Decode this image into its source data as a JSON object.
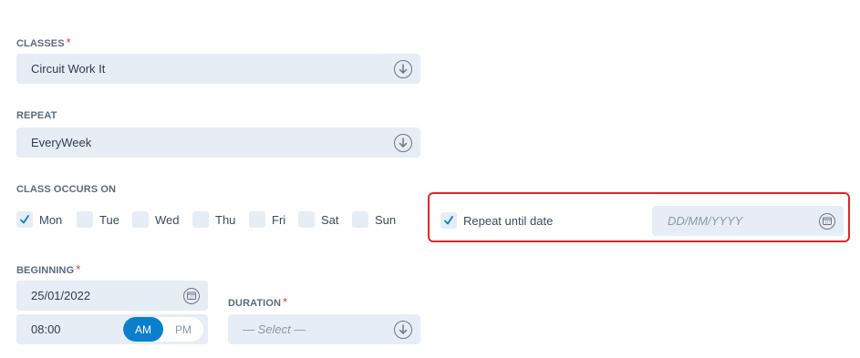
{
  "classes": {
    "label": "CLASSES",
    "required": "*",
    "value": "Circuit Work It"
  },
  "repeat": {
    "label": "REPEAT",
    "value": "EveryWeek"
  },
  "class_occurs_on": {
    "label": "CLASS OCCURS ON",
    "days": [
      {
        "label": "Mon",
        "checked": true
      },
      {
        "label": "Tue",
        "checked": false
      },
      {
        "label": "Wed",
        "checked": false
      },
      {
        "label": "Thu",
        "checked": false
      },
      {
        "label": "Fri",
        "checked": false
      },
      {
        "label": "Sat",
        "checked": false
      },
      {
        "label": "Sun",
        "checked": false
      }
    ]
  },
  "repeat_until": {
    "label": "Repeat until date",
    "checked": true,
    "date_placeholder": "DD/MM/YYYY"
  },
  "beginning": {
    "label": "BEGINNING",
    "required": "*",
    "date": "25/01/2022",
    "time": "08:00",
    "am": "AM",
    "pm": "PM",
    "selected": "AM"
  },
  "duration": {
    "label": "DURATION",
    "required": "*",
    "value": "— Select —"
  },
  "colors": {
    "accent": "#0b7fce",
    "field_bg": "#e6edf5",
    "required": "#e0353b",
    "highlight": "#e0242b"
  }
}
